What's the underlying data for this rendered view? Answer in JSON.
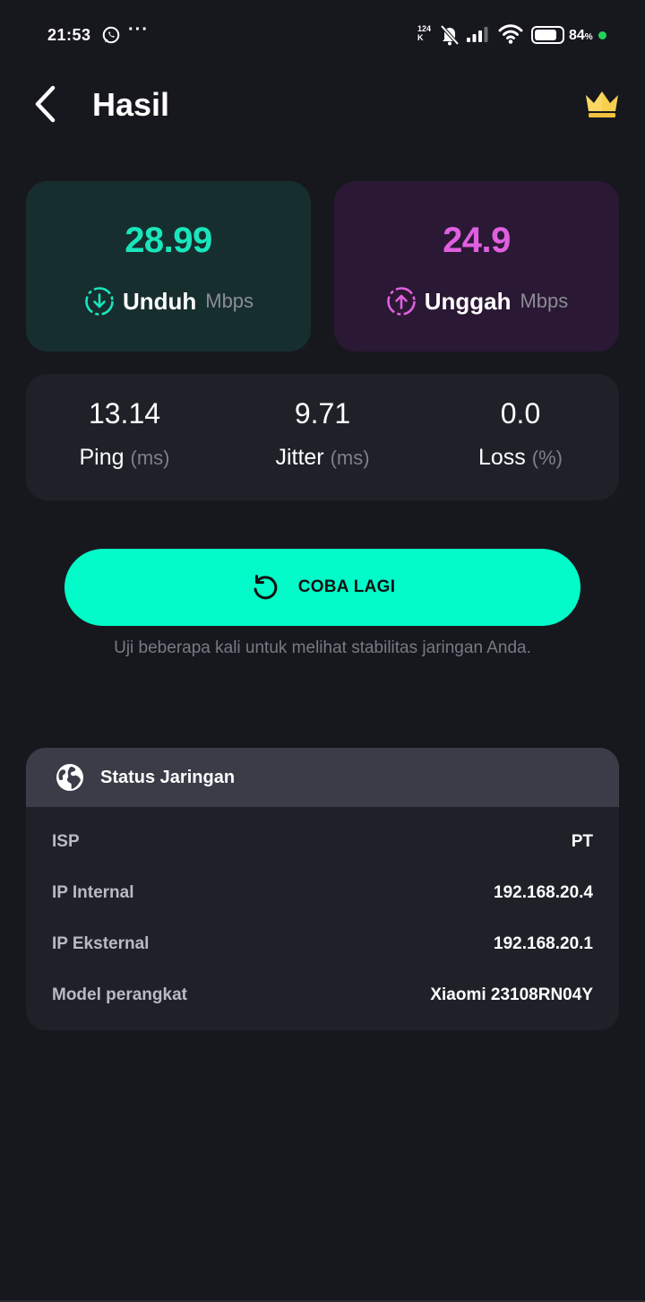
{
  "status_bar": {
    "time": "21:53",
    "more_indicator": "···",
    "net_speed_value": "124",
    "net_speed_unit": "K",
    "battery_percent": "84",
    "battery_percent_sign": "%",
    "battery_level": 0.84,
    "charge_dot_color": "#22d35a",
    "icons": [
      "whatsapp-icon",
      "muted-bell-icon",
      "signal-icon",
      "wifi-icon",
      "battery-icon"
    ]
  },
  "header": {
    "title": "Hasil",
    "back_icon": "chevron-left-icon",
    "premium_icon": "crown-icon"
  },
  "speed": {
    "download": {
      "value": "28.99",
      "label": "Unduh",
      "unit": "Mbps",
      "color": "#19e6bc",
      "icon": "download-circle-icon"
    },
    "upload": {
      "value": "24.9",
      "label": "Unggah",
      "unit": "Mbps",
      "color": "#e05fe0",
      "icon": "upload-circle-icon"
    }
  },
  "metrics": {
    "ping": {
      "value": "13.14",
      "label": "Ping",
      "unit": "(ms)"
    },
    "jitter": {
      "value": "9.71",
      "label": "Jitter",
      "unit": "(ms)"
    },
    "loss": {
      "value": "0.0",
      "label": "Loss",
      "unit": "(%)"
    }
  },
  "retry": {
    "label": "COBA LAGI",
    "hint": "Uji beberapa kali untuk melihat stabilitas jaringan Anda.",
    "color": "#02fbc8",
    "icon": "retry-icon"
  },
  "network_status": {
    "title": "Status Jaringan",
    "icon": "globe-icon",
    "rows": [
      {
        "key": "ISP",
        "value": "PT"
      },
      {
        "key": "IP Internal",
        "value": "192.168.20.4"
      },
      {
        "key": "IP Eksternal",
        "value": "192.168.20.1"
      },
      {
        "key": "Model perangkat",
        "value": "Xiaomi 23108RN04Y"
      }
    ]
  }
}
